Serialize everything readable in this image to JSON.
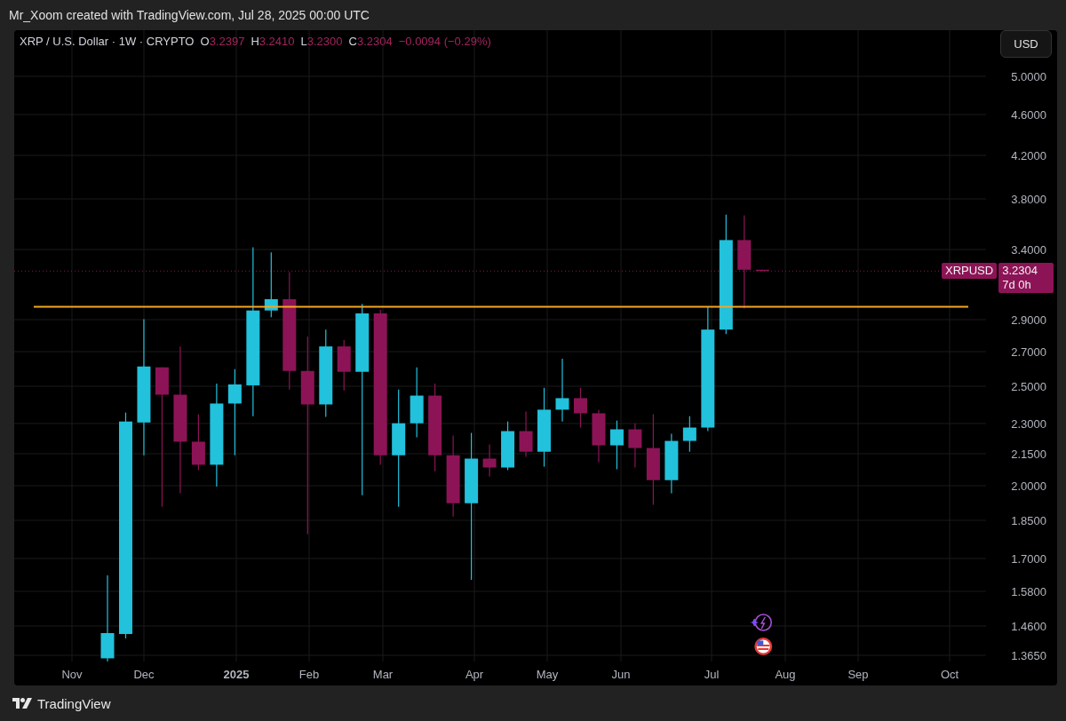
{
  "header": {
    "text": "Mr_Xoom created with TradingView.com, Jul 28, 2025 00:00 UTC"
  },
  "legend": {
    "title": "XRP / U.S. Dollar · 1W · CRYPTO",
    "change": "−0.0094 (−0.29%)",
    "ohlc": [
      {
        "key": "O",
        "value": "3.2397"
      },
      {
        "key": "H",
        "value": "3.2410"
      },
      {
        "key": "L",
        "value": "3.2300"
      },
      {
        "key": "C",
        "value": "3.2304"
      }
    ]
  },
  "currency_button": "USD",
  "price_label": {
    "symbol": "XRPUSD",
    "price": "3.2304",
    "countdown": "7d 0h"
  },
  "price_axis": {
    "labels": [
      "5.0000",
      "4.6000",
      "4.2000",
      "3.8000",
      "3.4000",
      "2.9000",
      "2.7000",
      "2.5000",
      "2.3000",
      "2.1500",
      "2.0000",
      "1.8500",
      "1.7000",
      "1.5800",
      "1.4600",
      "1.3650"
    ]
  },
  "time_axis": {
    "labels": [
      {
        "text": "Nov",
        "bold": false
      },
      {
        "text": "Dec",
        "bold": false
      },
      {
        "text": "2025",
        "bold": true
      },
      {
        "text": "Feb",
        "bold": false
      },
      {
        "text": "Mar",
        "bold": false
      },
      {
        "text": "Apr",
        "bold": false
      },
      {
        "text": "May",
        "bold": false
      },
      {
        "text": "Jun",
        "bold": false
      },
      {
        "text": "Jul",
        "bold": false
      },
      {
        "text": "Aug",
        "bold": false
      },
      {
        "text": "Sep",
        "bold": false
      },
      {
        "text": "Oct",
        "bold": false
      }
    ]
  },
  "footer": {
    "brand": "TradingView"
  }
}
